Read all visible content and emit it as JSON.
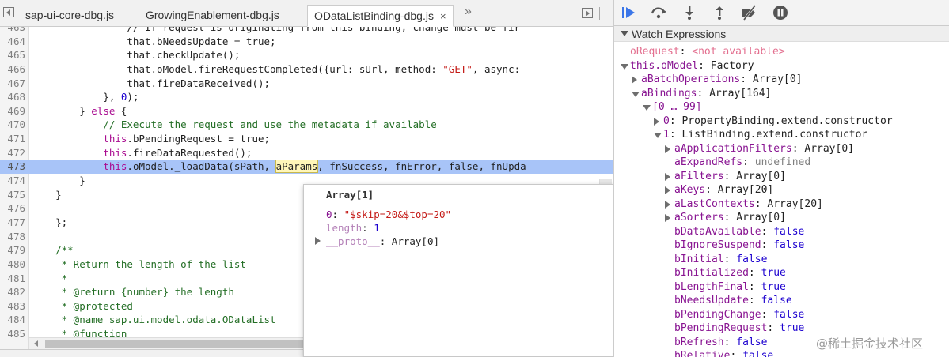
{
  "tabs": [
    {
      "label": "sap-ui-core-dbg.js",
      "active": false
    },
    {
      "label": "GrowingEnablement-dbg.js",
      "active": false
    },
    {
      "label": "ODataListBinding-dbg.js",
      "active": true,
      "close": "×"
    }
  ],
  "tabs_overflow": "»",
  "code": {
    "lines": [
      {
        "n": "463",
        "text": "                // If request is originating from this binding, change must be fir"
      },
      {
        "n": "464",
        "text": "                that.bNeedsUpdate = true;"
      },
      {
        "n": "465",
        "text": "                that.checkUpdate();"
      },
      {
        "n": "466",
        "pre": "                that.oModel.fireRequestCompleted({url: sUrl, method: ",
        "str": "\"GET\"",
        "post": ", async:"
      },
      {
        "n": "467",
        "text": "                that.fireDataReceived();"
      },
      {
        "n": "468",
        "pre": "            }, ",
        "num": "0",
        "post": ");"
      },
      {
        "n": "469",
        "pre": "        } ",
        "kw": "else",
        "post": " {"
      },
      {
        "n": "470",
        "comment": "            // Execute the request and use the metadata if available"
      },
      {
        "n": "471",
        "pre": "            ",
        "kw": "this",
        "post": ".bPendingRequest = true;"
      },
      {
        "n": "472",
        "pre": "            ",
        "kw": "this",
        "post": ".fireDataRequested();"
      },
      {
        "n": "473",
        "pre": "            ",
        "kw": "this",
        "post": ".oModel._loadData(sPath, ",
        "hover": "aParams",
        "tail": ", fnSuccess, fnError, false, fnUpda",
        "highlight": true
      },
      {
        "n": "474",
        "text": "        }"
      },
      {
        "n": "475",
        "text": "    }"
      },
      {
        "n": "476",
        "text": ""
      },
      {
        "n": "477",
        "text": "    };"
      },
      {
        "n": "478",
        "text": ""
      },
      {
        "n": "479",
        "comment": "    /**"
      },
      {
        "n": "480",
        "comment": "     * Return the length of the list"
      },
      {
        "n": "481",
        "comment": "     *"
      },
      {
        "n": "482",
        "comment": "     * @return {number} the length"
      },
      {
        "n": "483",
        "comment": "     * @protected"
      },
      {
        "n": "484",
        "comment": "     * @name sap.ui.model.odata.ODataList"
      },
      {
        "n": "485",
        "comment": "     * @function"
      }
    ]
  },
  "popover": {
    "title": "Array[1]",
    "rows": [
      {
        "key": "0",
        "sep": ": ",
        "value": "\"$skip=20&$top=20\"",
        "kind": "str"
      },
      {
        "key": "length",
        "sep": ": ",
        "value": "1",
        "kind": "num"
      },
      {
        "key": "__proto__",
        "sep": ": ",
        "value": "Array[0]",
        "kind": "obj",
        "expandable": true
      }
    ]
  },
  "watch": {
    "title": "Watch Expressions",
    "rows": [
      {
        "indent": 0,
        "tri": "none",
        "key": "oRequest",
        "sep": ": ",
        "value": "<not available>",
        "keyClass": "na",
        "valClass": "na"
      },
      {
        "indent": 0,
        "tri": "down",
        "key": "this.oModel",
        "sep": ": ",
        "value": "Factory"
      },
      {
        "indent": 1,
        "tri": "right",
        "key": "aBatchOperations",
        "sep": ": ",
        "value": "Array[0]"
      },
      {
        "indent": 1,
        "tri": "down",
        "key": "aBindings",
        "sep": ": ",
        "value": "Array[164]"
      },
      {
        "indent": 2,
        "tri": "down",
        "key": "[0 … 99]",
        "sep": "",
        "value": ""
      },
      {
        "indent": 3,
        "tri": "right",
        "key": "0",
        "sep": ": ",
        "value": "PropertyBinding.extend.constructor"
      },
      {
        "indent": 3,
        "tri": "down",
        "key": "1",
        "sep": ": ",
        "value": "ListBinding.extend.constructor"
      },
      {
        "indent": 4,
        "tri": "right",
        "key": "aApplicationFilters",
        "sep": ": ",
        "value": "Array[0]"
      },
      {
        "indent": 4,
        "tri": "none",
        "key": "aExpandRefs",
        "sep": ": ",
        "value": "undefined",
        "valClass": "v-undef"
      },
      {
        "indent": 4,
        "tri": "right",
        "key": "aFilters",
        "sep": ": ",
        "value": "Array[0]"
      },
      {
        "indent": 4,
        "tri": "right",
        "key": "aKeys",
        "sep": ": ",
        "value": "Array[20]"
      },
      {
        "indent": 4,
        "tri": "right",
        "key": "aLastContexts",
        "sep": ": ",
        "value": "Array[20]"
      },
      {
        "indent": 4,
        "tri": "right",
        "key": "aSorters",
        "sep": ": ",
        "value": "Array[0]"
      },
      {
        "indent": 4,
        "tri": "none",
        "key": "bDataAvailable",
        "sep": ": ",
        "value": "false",
        "valClass": "v-bool"
      },
      {
        "indent": 4,
        "tri": "none",
        "key": "bIgnoreSuspend",
        "sep": ": ",
        "value": "false",
        "valClass": "v-bool"
      },
      {
        "indent": 4,
        "tri": "none",
        "key": "bInitial",
        "sep": ": ",
        "value": "false",
        "valClass": "v-bool"
      },
      {
        "indent": 4,
        "tri": "none",
        "key": "bInitialized",
        "sep": ": ",
        "value": "true",
        "valClass": "v-bool"
      },
      {
        "indent": 4,
        "tri": "none",
        "key": "bLengthFinal",
        "sep": ": ",
        "value": "true",
        "valClass": "v-bool"
      },
      {
        "indent": 4,
        "tri": "none",
        "key": "bNeedsUpdate",
        "sep": ": ",
        "value": "false",
        "valClass": "v-bool"
      },
      {
        "indent": 4,
        "tri": "none",
        "key": "bPendingChange",
        "sep": ": ",
        "value": "false",
        "valClass": "v-bool"
      },
      {
        "indent": 4,
        "tri": "none",
        "key": "bPendingRequest",
        "sep": ": ",
        "value": "true",
        "valClass": "v-bool"
      },
      {
        "indent": 4,
        "tri": "none",
        "key": "bRefresh",
        "sep": ": ",
        "value": "false",
        "valClass": "v-bool"
      },
      {
        "indent": 4,
        "tri": "none",
        "key": "bRelative",
        "sep": ": ",
        "value": "false",
        "valClass": "v-bool"
      }
    ]
  },
  "toolbar_icons": [
    "resume-icon",
    "step-over-icon",
    "step-into-icon",
    "step-out-icon",
    "deactivate-breakpoints-icon",
    "pause-on-exceptions-icon"
  ],
  "watermark": "@稀土掘金技术社区",
  "colors": {
    "highlight_line": "#a8c4f8",
    "accent": "#3b76e8"
  }
}
